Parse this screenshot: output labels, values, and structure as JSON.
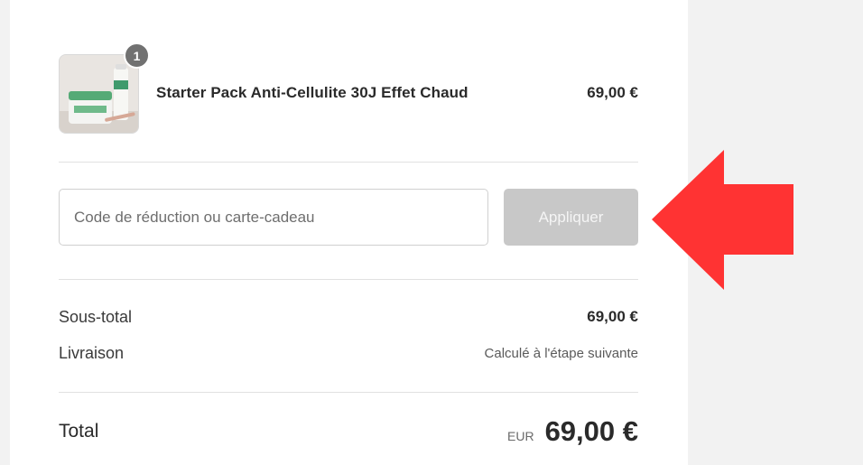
{
  "cart": {
    "item": {
      "name": "Starter Pack Anti-Cellulite 30J Effet Chaud",
      "price": "69,00 €",
      "quantity": "1",
      "thumbnail_icon": "product-photo"
    }
  },
  "discount": {
    "placeholder": "Code de réduction ou carte-cadeau",
    "apply_label": "Appliquer"
  },
  "summary": {
    "subtotal_label": "Sous-total",
    "subtotal_value": "69,00 €",
    "shipping_label": "Livraison",
    "shipping_value": "Calculé à l'étape suivante",
    "total_label": "Total",
    "currency": "EUR",
    "total_value": "69,00 €"
  },
  "colors": {
    "arrow": "#ff3333",
    "apply_button_disabled": "#c8c8c8",
    "badge": "#717171"
  },
  "annotation": {
    "arrow_icon": "left-arrow-icon"
  }
}
